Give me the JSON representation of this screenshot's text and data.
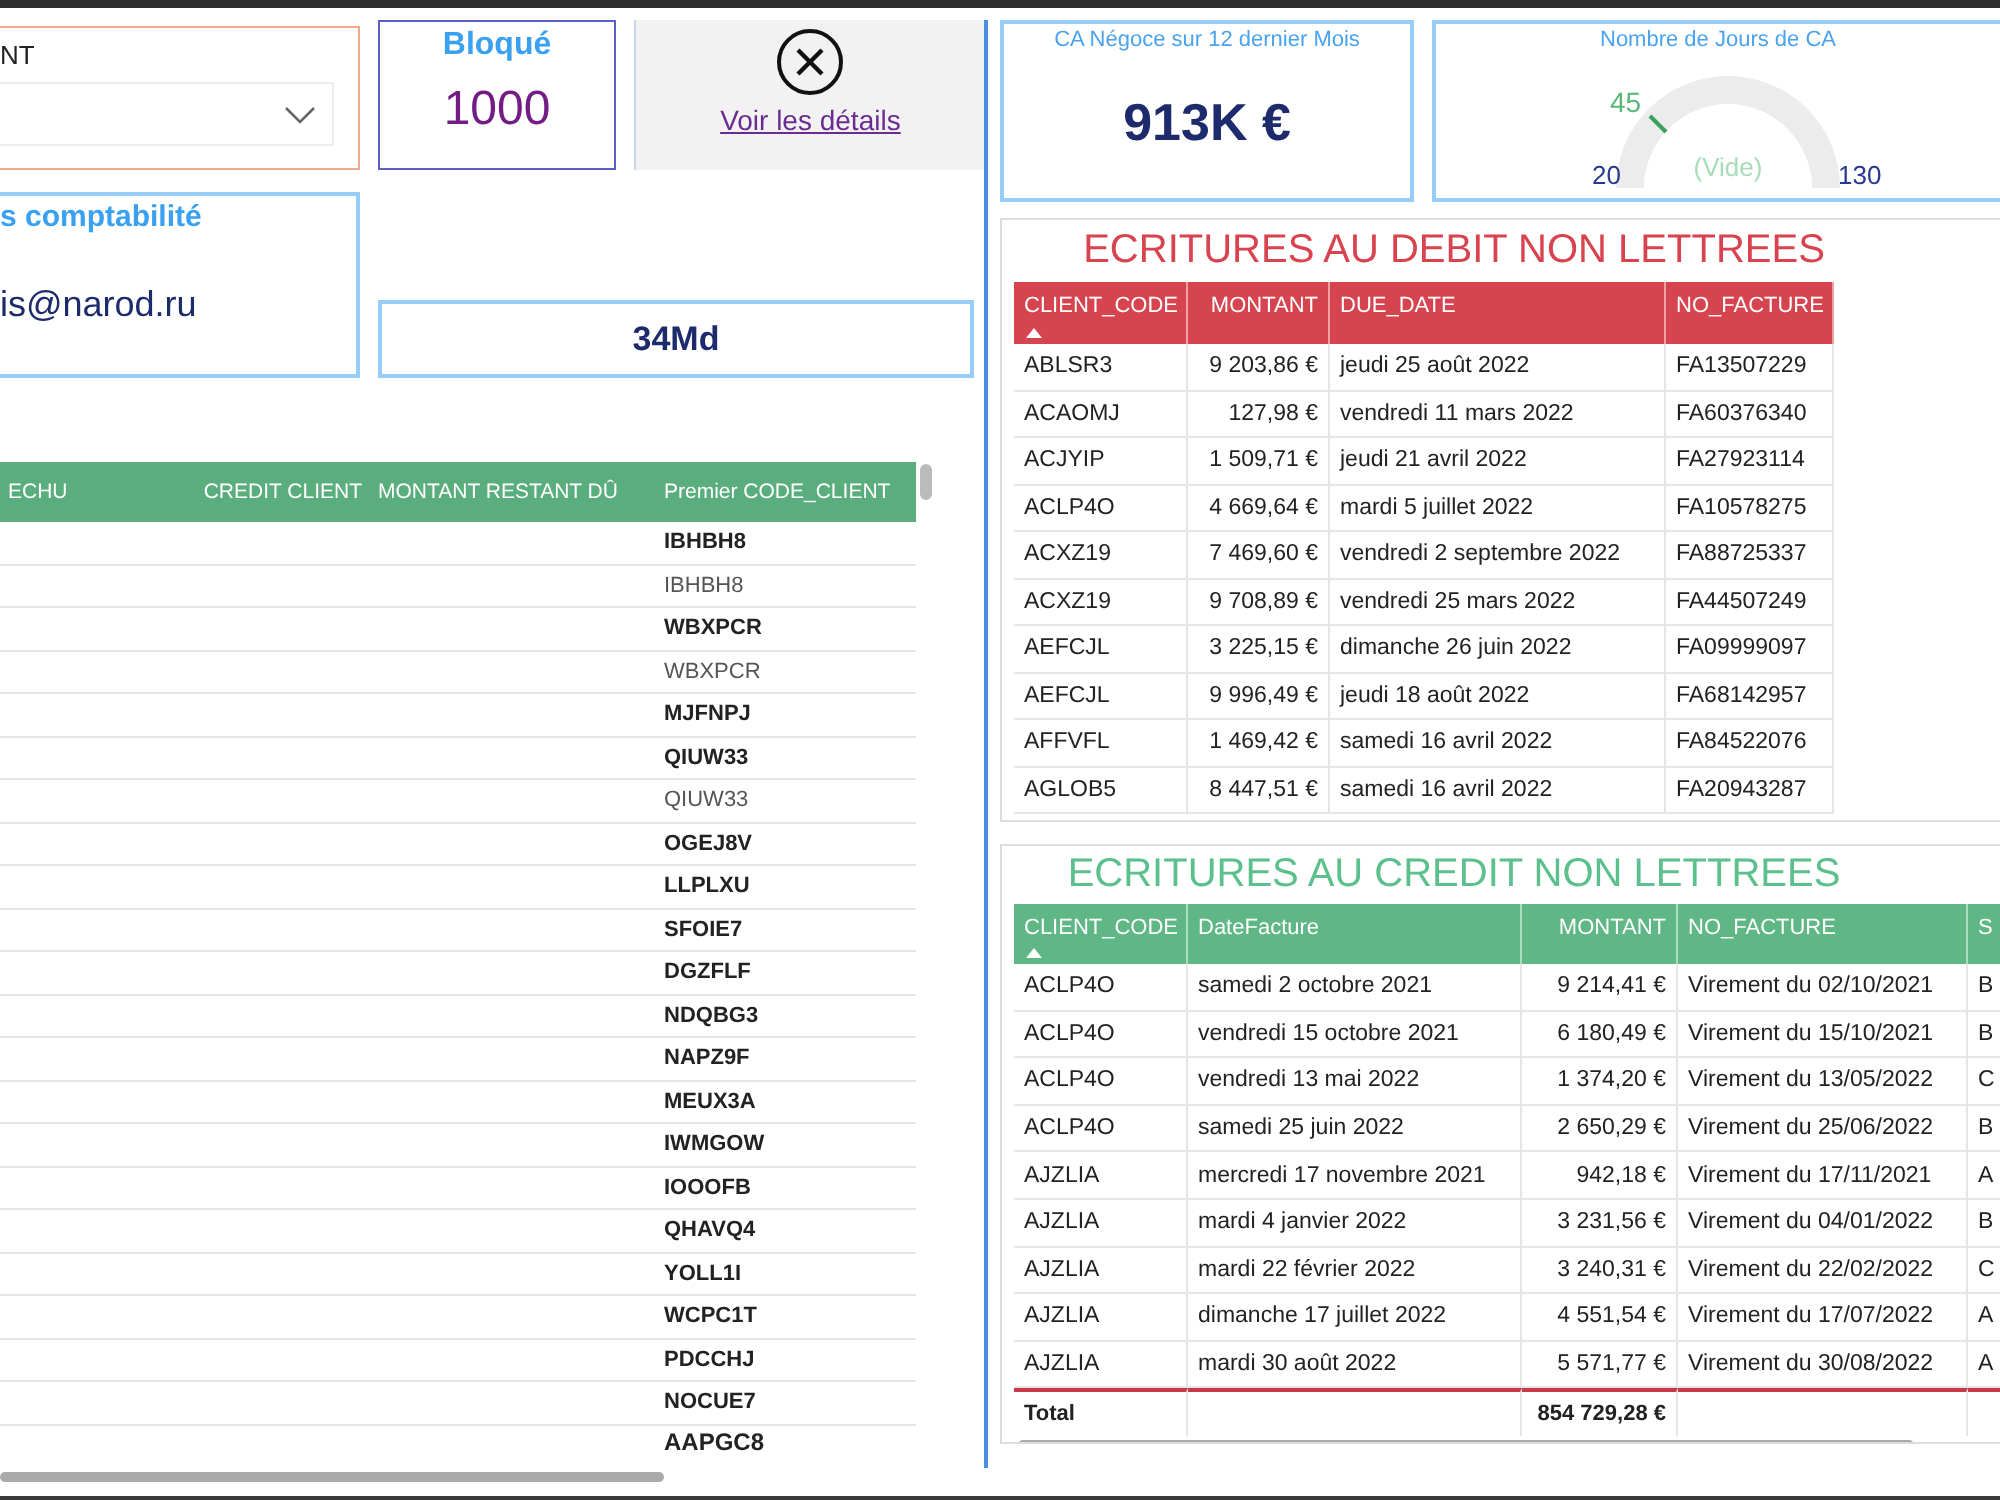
{
  "client_filter": {
    "label": "NT"
  },
  "blocked_card": {
    "title": "Bloqué",
    "value": "1000"
  },
  "details_button": {
    "label": "Voir les détails"
  },
  "accounting_card": {
    "title": "s comptabilité",
    "value": "is@narod.ru"
  },
  "metric_card": {
    "value": "34Md"
  },
  "client_table": {
    "columns": [
      {
        "label": "ECHU",
        "kind": "text"
      },
      {
        "label": "CREDIT CLIENT",
        "kind": "amount"
      },
      {
        "label": "MONTANT RESTANT DÛ",
        "kind": "text"
      },
      {
        "label": "Premier CODE_CLIENT",
        "kind": "text"
      }
    ],
    "rows": [
      {
        "code": "IBHBH8",
        "kind": "group"
      },
      {
        "code": "IBHBH8",
        "kind": "detail"
      },
      {
        "code": "WBXPCR",
        "kind": "group"
      },
      {
        "code": "WBXPCR",
        "kind": "detail"
      },
      {
        "code": "MJFNPJ",
        "kind": "group"
      },
      {
        "code": "QIUW33",
        "kind": "group"
      },
      {
        "code": "QIUW33",
        "kind": "detail"
      },
      {
        "code": "OGEJ8V",
        "kind": "group"
      },
      {
        "code": "LLPLXU",
        "kind": "group"
      },
      {
        "code": "SFOIE7",
        "kind": "group"
      },
      {
        "code": "DGZFLF",
        "kind": "group"
      },
      {
        "code": "NDQBG3",
        "kind": "group"
      },
      {
        "code": "NAPZ9F",
        "kind": "group"
      },
      {
        "code": "MEUX3A",
        "kind": "group"
      },
      {
        "code": "IWMGOW",
        "kind": "group"
      },
      {
        "code": "IOOOFB",
        "kind": "group"
      },
      {
        "code": "QHAVQ4",
        "kind": "group"
      },
      {
        "code": "YOLL1I",
        "kind": "group"
      },
      {
        "code": "WCPC1T",
        "kind": "group"
      },
      {
        "code": "PDCCHJ",
        "kind": "group"
      },
      {
        "code": "NOCUE7",
        "kind": "group"
      },
      {
        "code": "AAPGC8",
        "kind": "total"
      }
    ]
  },
  "revenue_card": {
    "title": "CA Négoce sur 12 dernier Mois",
    "value": "913K €"
  },
  "days_gauge": {
    "title": "Nombre de Jours de CA",
    "target": "45",
    "min": "20",
    "max": "130",
    "value": "(Vide)"
  },
  "debit_table": {
    "title": "ECRITURES AU DEBIT NON LETTREES",
    "columns": [
      {
        "label": "CLIENT_CODE",
        "kind": "text",
        "sorted": true
      },
      {
        "label": "MONTANT",
        "kind": "amount",
        "sorted": false
      },
      {
        "label": "DUE_DATE",
        "kind": "text",
        "sorted": false
      },
      {
        "label": "NO_FACTURE",
        "kind": "text",
        "sorted": false
      }
    ],
    "rows": [
      [
        "ABLSR3",
        "9 203,86 €",
        "jeudi 25 août 2022",
        "FA13507229"
      ],
      [
        "ACAOMJ",
        "127,98 €",
        "vendredi 11 mars 2022",
        "FA60376340"
      ],
      [
        "ACJYIP",
        "1 509,71 €",
        "jeudi 21 avril 2022",
        "FA27923114"
      ],
      [
        "ACLP4O",
        "4 669,64 €",
        "mardi 5 juillet 2022",
        "FA10578275"
      ],
      [
        "ACXZ19",
        "7 469,60 €",
        "vendredi 2 septembre 2022",
        "FA88725337"
      ],
      [
        "ACXZ19",
        "9 708,89 €",
        "vendredi 25 mars 2022",
        "FA44507249"
      ],
      [
        "AEFCJL",
        "3 225,15 €",
        "dimanche 26 juin 2022",
        "FA09999097"
      ],
      [
        "AEFCJL",
        "9 996,49 €",
        "jeudi 18 août 2022",
        "FA68142957"
      ],
      [
        "AFFVFL",
        "1 469,42 €",
        "samedi 16 avril 2022",
        "FA84522076"
      ],
      [
        "AGLOB5",
        "8 447,51 €",
        "samedi 16 avril 2022",
        "FA20943287"
      ]
    ]
  },
  "credit_table": {
    "title": "ECRITURES AU CREDIT NON LETTREES",
    "columns": [
      {
        "label": "CLIENT_CODE",
        "kind": "text",
        "sorted": true
      },
      {
        "label": "DateFacture",
        "kind": "text",
        "sorted": false
      },
      {
        "label": "MONTANT",
        "kind": "amount",
        "sorted": false
      },
      {
        "label": "NO_FACTURE",
        "kind": "text",
        "sorted": false
      },
      {
        "label": "S",
        "kind": "text",
        "sorted": false
      }
    ],
    "rows": [
      [
        "ACLP4O",
        "samedi 2 octobre 2021",
        "9 214,41 €",
        "Virement du 02/10/2021",
        "B"
      ],
      [
        "ACLP4O",
        "vendredi 15 octobre 2021",
        "6 180,49 €",
        "Virement du 15/10/2021",
        "B"
      ],
      [
        "ACLP4O",
        "vendredi 13 mai 2022",
        "1 374,20 €",
        "Virement du 13/05/2022",
        "C"
      ],
      [
        "ACLP4O",
        "samedi 25 juin 2022",
        "2 650,29 €",
        "Virement du 25/06/2022",
        "B"
      ],
      [
        "AJZLIA",
        "mercredi 17 novembre 2021",
        "942,18 €",
        "Virement du 17/11/2021",
        "A"
      ],
      [
        "AJZLIA",
        "mardi 4 janvier 2022",
        "3 231,56 €",
        "Virement du 04/01/2022",
        "B"
      ],
      [
        "AJZLIA",
        "mardi 22 février 2022",
        "3 240,31 €",
        "Virement du 22/02/2022",
        "C"
      ],
      [
        "AJZLIA",
        "dimanche 17 juillet 2022",
        "4 551,54 €",
        "Virement du 17/07/2022",
        "A"
      ],
      [
        "AJZLIA",
        "mardi 30 août 2022",
        "5 571,77 €",
        "Virement du 30/08/2022",
        "A"
      ]
    ],
    "total": {
      "label": "Total",
      "amount": "854 729,28 €"
    }
  }
}
